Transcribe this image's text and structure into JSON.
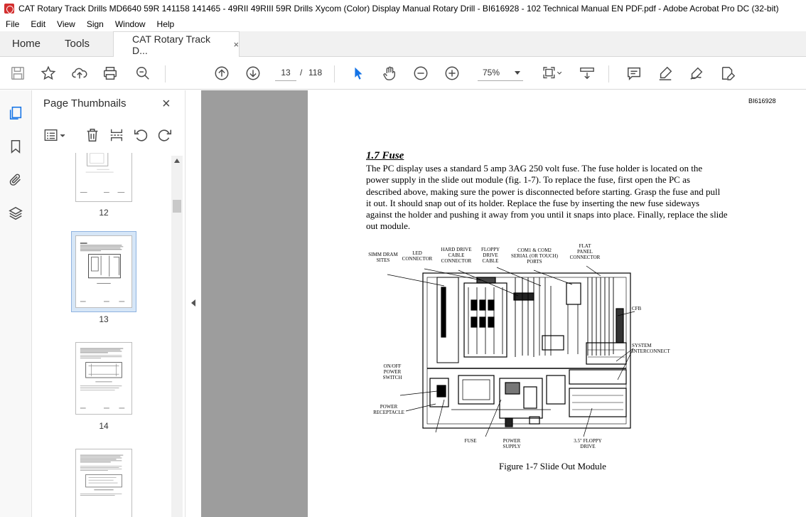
{
  "window": {
    "title": "CAT Rotary Track Drills MD6640 59R 141158 141465 - 49RII 49RIII 59R Drills Xycom (Color) Display Manual Rotary Drill - BI616928 - 102 Technical Manual EN PDF.pdf - Adobe Acrobat Pro DC (32-bit)"
  },
  "menu": [
    "File",
    "Edit",
    "View",
    "Sign",
    "Window",
    "Help"
  ],
  "tabs": {
    "home": "Home",
    "tools": "Tools",
    "document": "CAT Rotary Track D...",
    "close": "×"
  },
  "toolbar": {
    "page_current": "13",
    "page_sep": "/",
    "page_total": "118",
    "zoom": "75%",
    "icons": [
      "save-icon",
      "bookmark-star-icon",
      "upload-icon",
      "print-icon",
      "zoom-search-icon",
      "page-up-icon",
      "page-down-icon",
      "select-cursor-icon",
      "hand-icon",
      "zoom-out-icon",
      "zoom-in-icon",
      "fit-page-icon",
      "scroll-mode-icon",
      "comment-icon",
      "highlight-icon",
      "sign-icon",
      "edit-pdf-icon"
    ]
  },
  "thumbnails_panel": {
    "title": "Page Thumbnails",
    "close": "×",
    "pages": [
      {
        "label": "12"
      },
      {
        "label": "13",
        "selected": true
      },
      {
        "label": "14"
      },
      {
        "label": ""
      }
    ]
  },
  "page": {
    "doc_id": "BI616928",
    "section_title": "1.7  Fuse",
    "paragraph_lines": [
      "The PC display uses a standard 5 amp 3AG 250 volt fuse.  The fuse holder is located on the",
      "power supply in the slide out module (fig. 1-7).  To replace the fuse, first open the PC as",
      "described above, making sure the power is disconnected before starting.  Grasp the fuse and pull",
      "it out.  It should snap out of its holder.  Replace the fuse by inserting the new fuse sideways",
      "against the holder and pushing it away from you until it snaps into place.  Finally, replace the slide",
      "out module."
    ],
    "figure_labels": {
      "simm": "SIMM DRAM\nSITES",
      "led": "LED\nCONNECTOR",
      "hard_drive": "HARD DRIVE\nCABLE\nCONNECTOR",
      "floppy_cable": "FLOPPY\nDRIVE\nCABLE",
      "com": "COM1 & COM2\nSERIAL (OR TOUCH)\nPORTS",
      "flat_panel": "FLAT\nPANEL\nCONNECTOR",
      "cfb": "CFB",
      "system": "SYSTEM\nINTERCONNECT",
      "onoff": "ON/OFF\nPOWER\nSWITCH",
      "power_receptacle": "POWER\nRECEPTACLE",
      "fuse": "FUSE",
      "power_supply": "POWER\nSUPPLY",
      "floppy_drive": "3.5\" FLOPPY\nDRIVE"
    },
    "figure_caption": "Figure 1-7  Slide Out Module"
  },
  "colors": {
    "accent_blue": "#1473e6",
    "viewer_bg": "#9d9d9d",
    "icon_gray": "#4b4b4b"
  }
}
